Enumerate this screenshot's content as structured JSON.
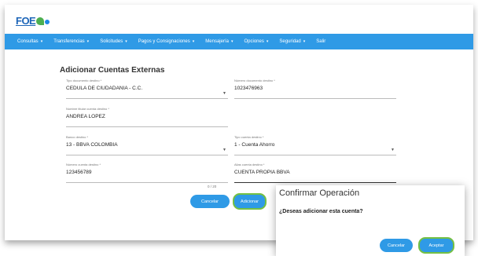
{
  "logo": {
    "text": "FOE"
  },
  "navbar": {
    "items": [
      {
        "label": "Consultas",
        "caret": "▾"
      },
      {
        "label": "Transferencias",
        "caret": "▾"
      },
      {
        "label": "Solicitudes",
        "caret": "▾"
      },
      {
        "label": "Pagos y Consignaciones",
        "caret": "▾"
      },
      {
        "label": "Mensajería",
        "caret": "▾"
      },
      {
        "label": "Opciones",
        "caret": "▾"
      },
      {
        "label": "Seguridad",
        "caret": "▾"
      },
      {
        "label": "Salir",
        "caret": ""
      }
    ]
  },
  "form": {
    "title": "Adicionar Cuentas Externas",
    "tipo_documento": {
      "label": "Tipo documento destino *",
      "value": "CEDULA DE CIUDADANIA - C.C."
    },
    "numero_documento": {
      "label": "Número documento destino *",
      "value": "1023476963"
    },
    "nombre_titular": {
      "label": "Nombre titular cuenta destino *",
      "value": "ANDREA LOPEZ"
    },
    "banco": {
      "label": "Banco destino *",
      "value": "13 - BBVA COLOMBIA"
    },
    "tipo_cuenta": {
      "label": "Tipo cuenta destino *",
      "value": "1 - Cuenta Ahorro"
    },
    "numero_cuenta": {
      "label": "Número cuenta destino *",
      "value": "123456789"
    },
    "alias_cuenta": {
      "label": "Alias cuenta destino *",
      "value": "CUENTA PROPIA BBVA"
    },
    "alias_counter": "0 / 20",
    "cancel_label": "Cancelar",
    "submit_label": "Adicionar"
  },
  "dialog": {
    "title": "Confirmar Operación",
    "message": "¿Deseas adicionar esta cuenta?",
    "cancel_label": "Cancelar",
    "accept_label": "Aceptar"
  },
  "colors": {
    "navbar": "#2f9ae6",
    "primary_button": "#2f9ae6",
    "focus_outline": "#74c043"
  }
}
